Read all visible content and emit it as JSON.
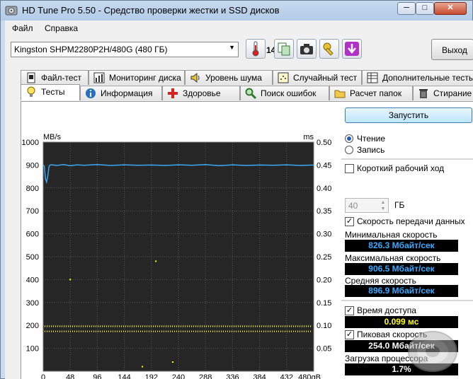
{
  "window": {
    "title": "HD Tune Pro 5.50 - Средство проверки жестки и SSD дисков",
    "minimize_label": "─",
    "maximize_label": "□",
    "close_label": "✕"
  },
  "menu": {
    "file": "Файл",
    "help": "Справка"
  },
  "toolbar": {
    "drive": "Kingston SHPM2280P2H/480G (480 ГБ)",
    "temperature": "14",
    "exit_label": "Выход"
  },
  "tabs_top": [
    "Файл-тест",
    "Мониторинг диска",
    "Уровень шума",
    "Случайный тест",
    "Дополнительные тесты"
  ],
  "tabs_bottom": [
    "Тесты",
    "Информация",
    "Здоровье",
    "Поиск ошибок",
    "Расчет папок",
    "Стирание"
  ],
  "controls": {
    "start_label": "Запустить",
    "read_label": "Чтение",
    "write_label": "Запись",
    "short_stroke_label": "Короткий рабочий ход",
    "short_stroke_value": "40",
    "short_stroke_unit": "ГБ",
    "transfer_rate_label": "Скорость передачи данных",
    "access_time_label": "Время доступа",
    "burst_rate_label": "Пиковая скорость",
    "cpu_label": "Загрузка процессора"
  },
  "results": {
    "min_label": "Минимальная скорость",
    "min_value": "826.3 Мбайт/сек",
    "max_label": "Максимальная скорость",
    "max_value": "906.5 Мбайт/сек",
    "avg_label": "Средняя скорость",
    "avg_value": "896.9 Мбайт/сек",
    "access_value": "0.099 мс",
    "burst_value": "254.0 Мбайт/сек",
    "cpu_value": "1.7%"
  },
  "colors": {
    "speed_line": "#3aa7f5",
    "access_points": "#ffff00",
    "plot_bg": "#262626",
    "grid": "#5a5a5a"
  },
  "chart_data": {
    "type": "line",
    "left_axis_unit": "MB/s",
    "right_axis_unit": "ms",
    "x_unit": "gB",
    "ylim": [
      0,
      1000
    ],
    "y2lim": [
      0,
      0.5
    ],
    "xlim": [
      0,
      480
    ],
    "y_ticks": [
      "1000",
      "900",
      "800",
      "700",
      "600",
      "500",
      "400",
      "300",
      "200",
      "100"
    ],
    "y2_ticks": [
      "0.50",
      "0.45",
      "0.40",
      "0.35",
      "0.30",
      "0.25",
      "0.20",
      "0.15",
      "0.10",
      "0.05"
    ],
    "x_ticks": [
      "0",
      "48",
      "96",
      "144",
      "192",
      "240",
      "288",
      "336",
      "384",
      "432",
      "480gB"
    ],
    "grid": true,
    "series": [
      {
        "values_kind": "transfer_rate_mb_s",
        "x": [
          0,
          2,
          4,
          6,
          8,
          10,
          12,
          16,
          24,
          36,
          48,
          60,
          72,
          96,
          120,
          144,
          168,
          192,
          216,
          240,
          264,
          288,
          312,
          336,
          360,
          384,
          408,
          432,
          456,
          480
        ],
        "y": [
          900,
          895,
          840,
          826,
          850,
          890,
          900,
          901,
          898,
          902,
          897,
          901,
          899,
          902,
          898,
          901,
          899,
          900,
          898,
          901,
          899,
          902,
          897,
          901,
          898,
          900,
          899,
          901,
          898,
          900
        ]
      },
      {
        "values_kind": "access_time_ms",
        "bands_ms": [
          0.098,
          0.087
        ],
        "outliers": [
          {
            "x": 200,
            "y": 0.24
          },
          {
            "x": 48,
            "y": 0.2
          },
          {
            "x": 230,
            "y": 0.02
          },
          {
            "x": 176,
            "y": 0.01
          }
        ]
      }
    ]
  }
}
